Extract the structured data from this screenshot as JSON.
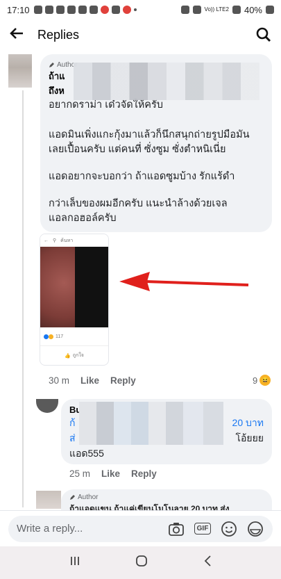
{
  "statusbar": {
    "time": "17:10",
    "battery": "40%",
    "signal_label": "Vo)) LTE2"
  },
  "header": {
    "title": "Replies"
  },
  "comment": {
    "author_badge": "Author",
    "name_fragment": "ถ้าแ",
    "second_fragment": "ถึงห",
    "paragraphs": [
      "อยากดราม่า เด๋วจัดให้ครับ",
      "แอดมินเพิ่งแกะกุ้งมาแล้วก็นึกสนุกถ่ายรูปมือมัน เลยเปื้อนครับ แต่คนที่ ซั่งซูม ซั่งตำหนิเนี่ย",
      "แอดอยากจะบอกว่า ถ้าแอดซูมบ้าง รักแร้ดำ",
      "กว่าเล็บของผมอีกครับ แนะนำล้างด้วยเจล แอลกอฮอล์ครับ"
    ],
    "attachment": {
      "search_placeholder": "ค้นหา",
      "reaction_count": "117",
      "like_label": "ถูกใจ"
    },
    "time": "30 m",
    "like": "Like",
    "reply": "Reply",
    "reaction_total": "9"
  },
  "reply1": {
    "name_fragment": "Bu",
    "link_line1_fragment": "ก้",
    "link_line1_end": "20 บาท",
    "link_line2_start": "ส่",
    "line2_end": "โอ้ยยย",
    "line3": "แอด555",
    "time": "25 m",
    "like": "Like",
    "reply": "Reply"
  },
  "reply2": {
    "author_badge": "Author",
    "cut_text": "ถ้าแอดแขน ถ้าแค่เขียนโมโนลาย 20 บาท ส่ง"
  },
  "composer": {
    "placeholder": "Write a reply..."
  },
  "icons": {
    "back": "arrow-left-icon",
    "search": "search-icon",
    "camera": "camera-icon",
    "gif": "GIF",
    "emoji": "emoji-icon",
    "sticker": "sticker-icon"
  },
  "colors": {
    "link": "#1877f2",
    "arrow": "#e0201c",
    "bubble": "#f0f2f5"
  }
}
